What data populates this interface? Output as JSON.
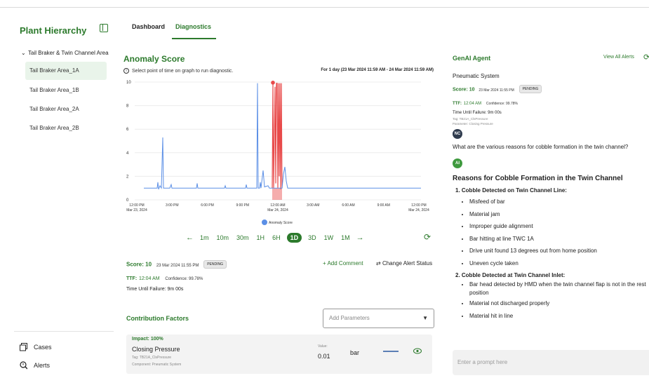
{
  "sidebar": {
    "title": "Plant Hierarchy",
    "root_label": "Tail Braker & Twin Channel Area",
    "items": [
      {
        "label": "Tail Braker Area_1A",
        "selected": true
      },
      {
        "label": "Tail Braker Area_1B",
        "selected": false
      },
      {
        "label": "Tail Braker Area_2A",
        "selected": false
      },
      {
        "label": "Tail Braker Area_2B",
        "selected": false
      }
    ],
    "nav": [
      {
        "label": "Cases",
        "icon": "copy-icon"
      },
      {
        "label": "Alerts",
        "icon": "search-alert-icon"
      }
    ]
  },
  "tabs": [
    {
      "label": "Dashboard",
      "active": false
    },
    {
      "label": "Diagnostics",
      "active": true
    }
  ],
  "anomaly": {
    "title": "Anomaly Score",
    "hint": "Select point of time on graph to run diagnostic.",
    "range": "For 1 day (23 Mar 2024 11:59 AM - 24 Mar 2024 11:59 AM)",
    "legend": "Anomaly Score",
    "timeframes": [
      "1m",
      "10m",
      "30m",
      "1H",
      "6H",
      "1D",
      "3D",
      "1W",
      "1M"
    ],
    "active_timeframe": "1D"
  },
  "chart_data": {
    "type": "line",
    "series": [
      {
        "name": "Anomaly Score",
        "color": "#5b8fe6"
      }
    ],
    "y_ticks": [
      "0",
      "2",
      "4",
      "6",
      "8",
      "10"
    ],
    "ylim": [
      0,
      10
    ],
    "x_ticks": [
      {
        "time": "12:00 PM",
        "date": "Mar 23, 2024"
      },
      {
        "time": "3:00 PM",
        "date": ""
      },
      {
        "time": "6:00 PM",
        "date": ""
      },
      {
        "time": "9:00 PM",
        "date": ""
      },
      {
        "time": "12:00 AM",
        "date": "Mar 24, 2024"
      },
      {
        "time": "3:00 AM",
        "date": ""
      },
      {
        "time": "6:00 AM",
        "date": ""
      },
      {
        "time": "9:00 AM",
        "date": ""
      },
      {
        "time": "12:00 PM",
        "date": "Mar 24, 2024"
      }
    ],
    "highlight_color": "#e84a4a"
  },
  "score_card": {
    "score_label": "Score: 10",
    "date": "23 Mar 2024 11:55 PM",
    "status": "PENDING",
    "ttf_label": "TTF:",
    "ttf_time": "12:04 AM",
    "confidence": "Confidence: 99.78%",
    "time_until_failure": "Time Until Failure: 9m 00s",
    "add_comment": "Add Comment",
    "change_status": "Change Alert Status"
  },
  "contribution": {
    "title": "Contribution Factors",
    "add_params_placeholder": "Add Parameters",
    "factor": {
      "impact": "Impact: 100%",
      "name": "Closing Pressure",
      "tag": "Tag: TB21A_ClsPressure",
      "component": "Component: Pneumatic System",
      "value_label": "Value:",
      "value": "0.01",
      "unit": "bar"
    }
  },
  "genai": {
    "title": "GenAI Agent",
    "view_all": "View All Alerts",
    "system": "Pneumatic System",
    "score_label": "Score: 10",
    "date": "23 Mar 2024 11:55 PM",
    "status": "PENDING",
    "ttf_label": "TTF:",
    "ttf_time": "12:04 AM",
    "confidence": "Confidence: 99.78%",
    "time_until_failure": "Time Until Failure: 9m 00s",
    "tag": "Tag: TB21A_ClsPressure",
    "parameter": "Parameter: Closing Pressure",
    "user_initials": "NC",
    "question": "What are the various reasons for cobble formation in the twin channel?",
    "ai_initials": "AI",
    "answer_title": "Reasons for Cobble Formation in the Twin Channel",
    "sections": [
      {
        "heading": "1. Cobble Detected on Twin Channel Line:",
        "bullets": [
          "Misfeed of bar",
          "Material jam",
          "Improper guide alignment",
          "Bar hitting at line TWC 1A",
          "Drive unit found 13 degrees out from home position",
          "Uneven cycle taken"
        ]
      },
      {
        "heading": "2. Cobble Detected at Twin Channel Inlet:",
        "bullets": [
          "Bar head detected by HMD when the twin channel flap is not in the rest position",
          "Material not discharged properly",
          "Material hit in line"
        ]
      }
    ],
    "prompt_placeholder": "Enter a prompt here"
  }
}
